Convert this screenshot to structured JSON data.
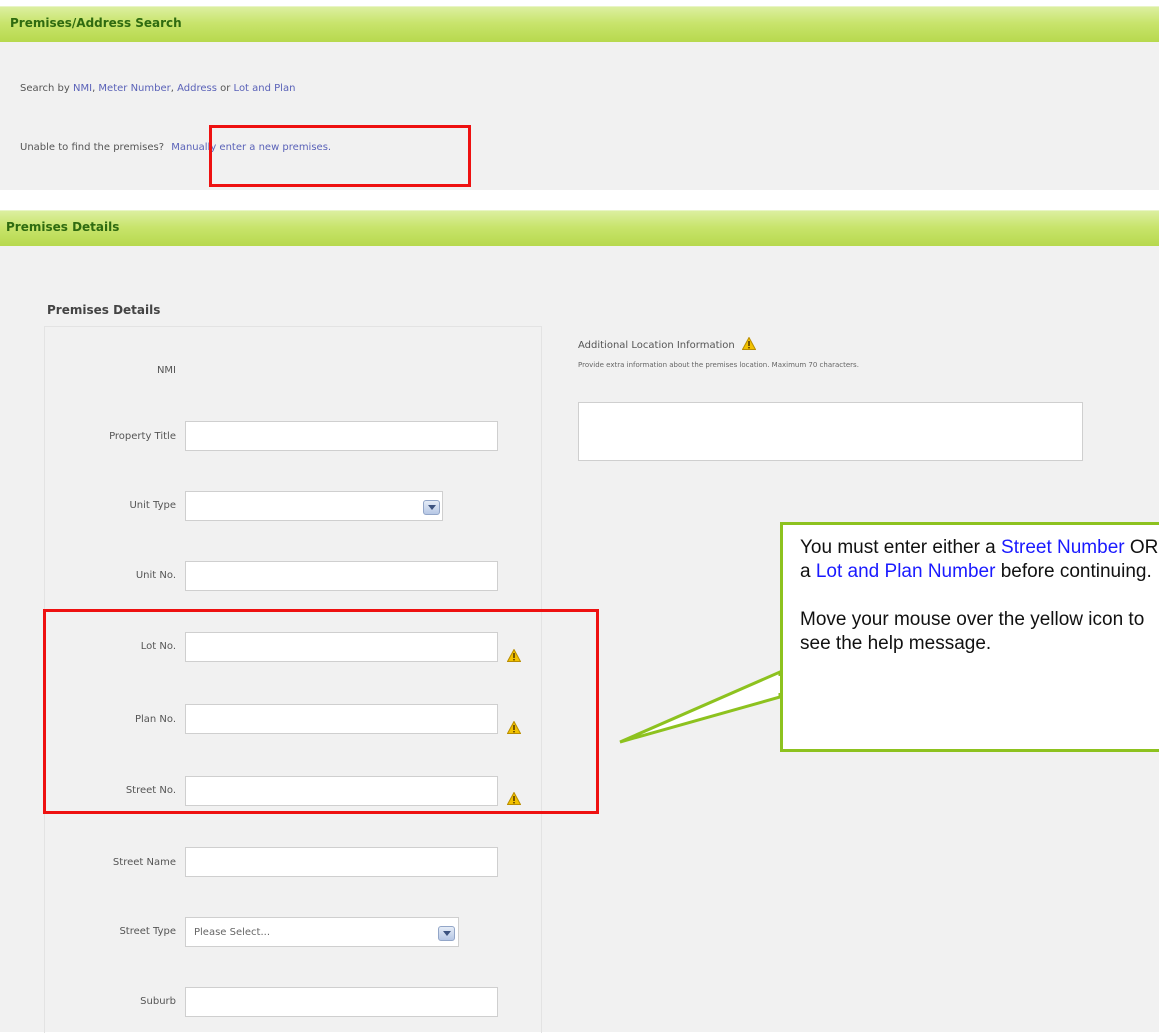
{
  "search_section": {
    "title": "Premises/Address Search",
    "search_by_prefix": "Search by",
    "link_nmi": "NMI",
    "link_meter": "Meter Number",
    "link_address": "Address",
    "conj_or": "or",
    "link_lot_plan": "Lot and Plan",
    "unable_text": "Unable to find the premises?",
    "manual_link": "Manually enter a new premises."
  },
  "details_section": {
    "title": "Premises Details",
    "subheading": "Premises Details",
    "fields": {
      "nmi": "NMI",
      "property_title": "Property Title",
      "unit_type": "Unit Type",
      "unit_no": "Unit No.",
      "lot_no": "Lot No.",
      "plan_no": "Plan No.",
      "street_no": "Street No.",
      "street_name": "Street Name",
      "street_type": "Street Type",
      "street_type_value": "Please Select...",
      "suburb": "Suburb"
    },
    "additional": {
      "title": "Additional Location Information",
      "help": "Provide extra information about the premises location. Maximum 70 characters."
    }
  },
  "callout": {
    "p1_a": "You must enter either a",
    "p1_link1": "Street Number",
    "p1_b": "OR a",
    "p1_link2": "Lot and Plan Number",
    "p1_c": "before continuing.",
    "p2": "Move your mouse over the yellow icon to see the help message."
  },
  "colors": {
    "header_green": "#b6d84c",
    "header_text": "#2f6b10",
    "link": "#5a62b8",
    "highlight_red": "#ee1111",
    "callout_border": "#8dc21f",
    "callout_link": "#1a1aff"
  }
}
